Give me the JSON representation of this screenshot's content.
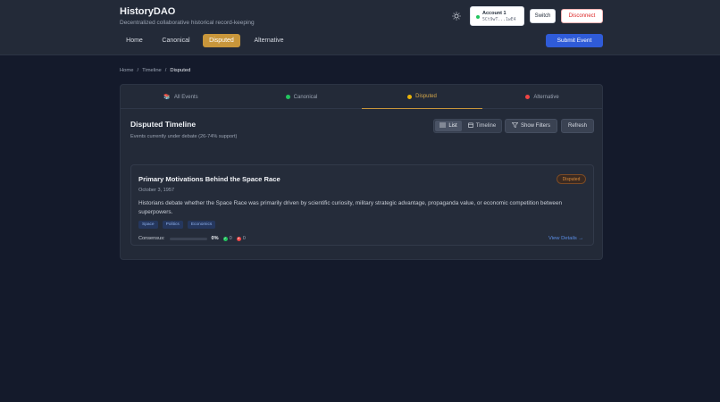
{
  "app": {
    "title": "HistoryDAO",
    "subtitle": "Decentralized collaborative historical record-keeping"
  },
  "header": {
    "theme_icon": "sun-icon",
    "account": {
      "name": "Account 1",
      "address": "5Ct9wT...1wE4",
      "status_color": "#22c55e"
    },
    "switch_label": "Switch",
    "disconnect_label": "Disconnect",
    "submit_label": "Submit Event"
  },
  "nav": {
    "items": [
      {
        "label": "Home",
        "active": false
      },
      {
        "label": "Canonical",
        "active": false
      },
      {
        "label": "Disputed",
        "active": true
      },
      {
        "label": "Alternative",
        "active": false
      }
    ],
    "accent_color": "#c8963b"
  },
  "breadcrumb": {
    "home": "Home",
    "timeline": "Timeline",
    "current": "Disputed",
    "separator": "/"
  },
  "tabs": [
    {
      "label": "All Events",
      "icon": "books-icon",
      "active": false
    },
    {
      "label": "Canonical",
      "color": "#22c55e",
      "active": false
    },
    {
      "label": "Disputed",
      "color": "#eab308",
      "active": true
    },
    {
      "label": "Alternative",
      "color": "#ef4444",
      "active": false
    }
  ],
  "section": {
    "title": "Disputed Timeline",
    "subtitle": "Events currently under debate (26-74% support)"
  },
  "view_toggle": {
    "list_label": "List",
    "timeline_label": "Timeline",
    "selected": "List"
  },
  "toolbar": {
    "filters_label": "Show Filters",
    "refresh_label": "Refresh"
  },
  "event": {
    "title": "Primary Motivations Behind the Space Race",
    "date": "October 3, 1957",
    "status": "Disputed",
    "description": "Historians debate whether the Space Race was primarily driven by scientific curiosity, military strategic advantage, propaganda value, or economic competition between superpowers.",
    "tags": [
      "Space",
      "Politics",
      "Economics"
    ],
    "consensus_label": "Consensus:",
    "consensus_percent": 0,
    "consensus_text": "0%",
    "upvotes": "0",
    "downvotes": "0",
    "view_details_label": "View Details →"
  }
}
